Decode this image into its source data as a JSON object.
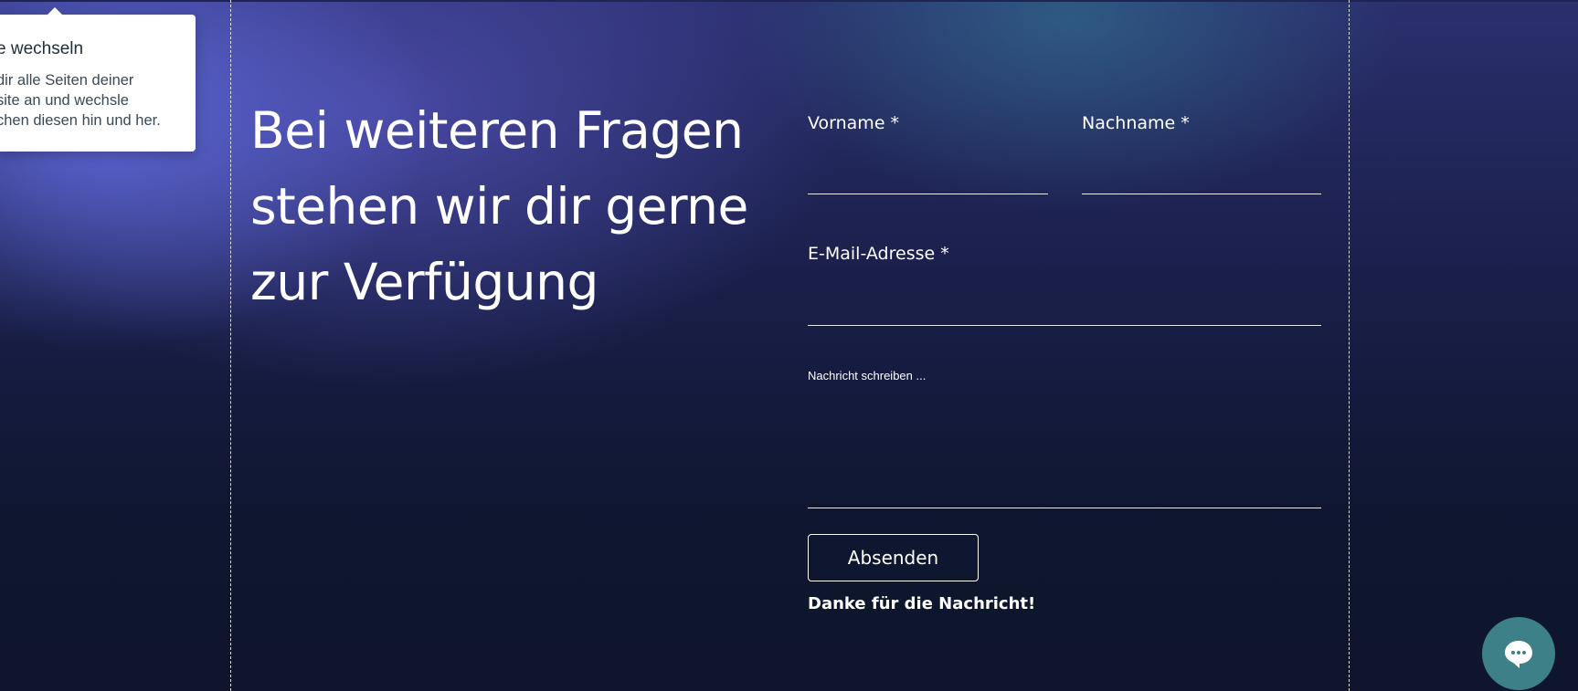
{
  "tooltip": {
    "title": "e wechseln",
    "body_lines": [
      "dir alle Seiten deiner",
      "site an und wechsle",
      "chen diesen hin und her."
    ]
  },
  "heading": {
    "lines": [
      "Bei weiteren Fragen",
      "stehen wir dir gerne",
      "zur Verfügung"
    ]
  },
  "form": {
    "first_name_label": "Vorname *",
    "last_name_label": "Nachname *",
    "email_label": "E-Mail-Adresse *",
    "message_placeholder": "Nachricht schreiben ...",
    "submit_label": "Absenden",
    "success_message": "Danke für die Nachricht!"
  },
  "chat": {
    "icon": "chat-bubble-icon"
  },
  "colors": {
    "text": "#ffffff",
    "chat_button": "#3d8088",
    "background_dark": "#0f1630",
    "background_glow": "#6470e6"
  }
}
